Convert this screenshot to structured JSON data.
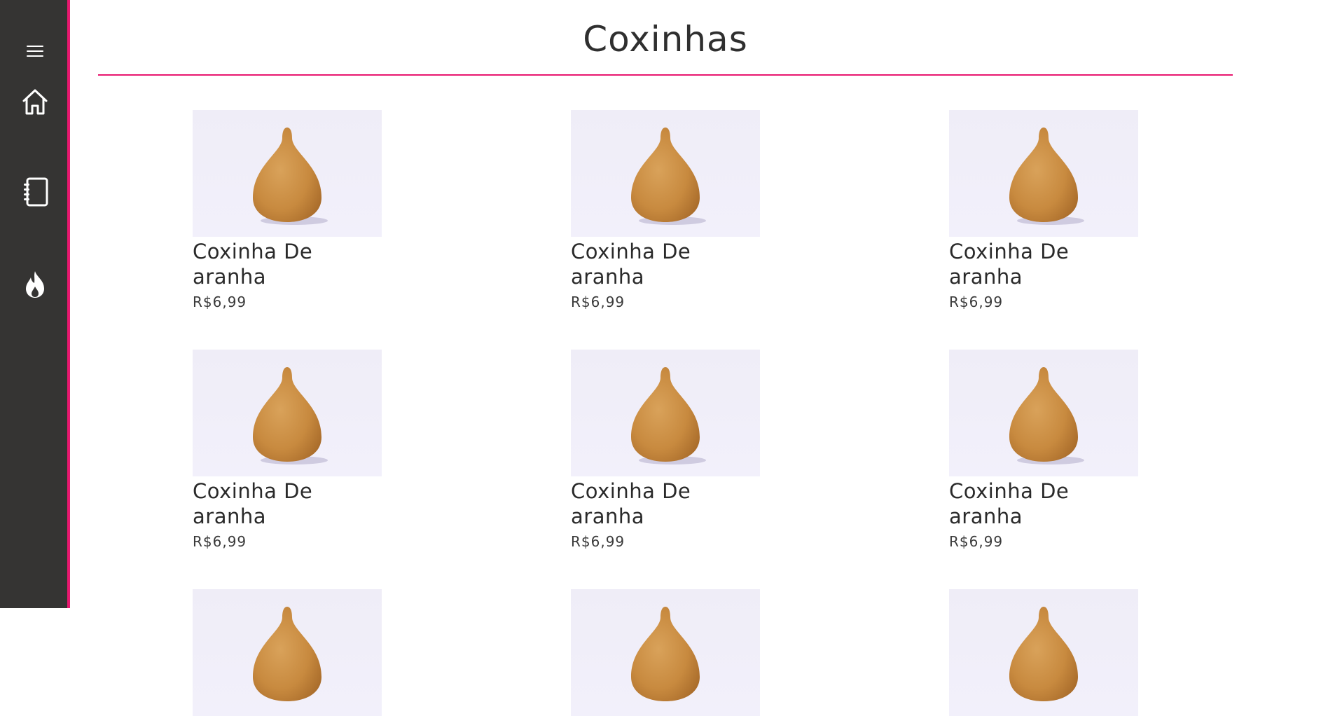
{
  "sidebar": {
    "items": [
      {
        "icon": "menu-icon"
      },
      {
        "icon": "home-icon"
      },
      {
        "icon": "notebook-icon"
      },
      {
        "icon": "flame-icon"
      }
    ],
    "accent": "#e8176f",
    "background": "#353433"
  },
  "page": {
    "title": "Coxinhas"
  },
  "products": [
    {
      "name": "Coxinha De aranha",
      "price": "R$6,99"
    },
    {
      "name": "Coxinha De aranha",
      "price": "R$6,99"
    },
    {
      "name": "Coxinha De aranha",
      "price": "R$6,99"
    },
    {
      "name": "Coxinha De aranha",
      "price": "R$6,99"
    },
    {
      "name": "Coxinha De aranha",
      "price": "R$6,99"
    },
    {
      "name": "Coxinha De aranha",
      "price": "R$6,99"
    },
    {
      "name": "",
      "price": ""
    },
    {
      "name": "",
      "price": ""
    },
    {
      "name": "",
      "price": ""
    }
  ]
}
